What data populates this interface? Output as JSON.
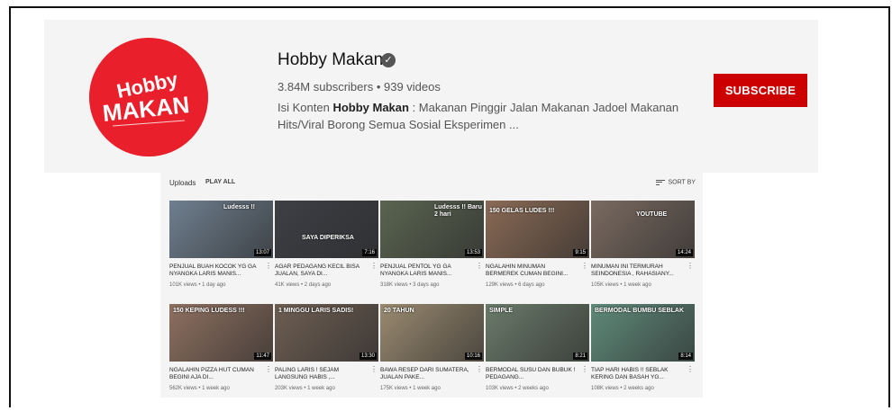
{
  "channel": {
    "name": "Hobby Makan",
    "stats": "3.84M subscribers • 939 videos",
    "description_lead": "Isi Konten ",
    "description_bold": "Hobby Makan",
    "description_rest": " : Makanan Pinggir Jalan Makanan Jadoel Makanan Hits/Viral Borong Semua Sosial Eksperimen ...",
    "subscribe_label": "SUBSCRIBE",
    "logo_top": "Hobby",
    "logo_bottom": "MAKAN",
    "accent": "#cc0000"
  },
  "uploads": {
    "title": "Uploads",
    "play_all": "PLAY ALL",
    "sort_label": "SORT BY",
    "videos": [
      {
        "title": "PENJUAL BUAH KOCOK YG GA NYANGKA LARIS MANIS...",
        "meta": "101K views • 1 day ago",
        "duration": "13:07",
        "caption": "Ludesss !!",
        "bg": "#6f7f8f"
      },
      {
        "title": "AGAR PEDAGANG KECIL BISA JUALAN, SAYA DI...",
        "meta": "41K views • 2 days ago",
        "duration": "7:16",
        "caption": "SAYA DIPERIKSA",
        "bg": "#3d3f45"
      },
      {
        "title": "PENJUAL PENTOL YG GA NYANGKA LARIS MANIS...",
        "meta": "318K views • 3 days ago",
        "duration": "13:53",
        "caption": "Ludesss !! Baru 2 hari",
        "bg": "#5a6450"
      },
      {
        "title": "NGALAHIN MINUMAN BERMEREK CUMAN BEGINI...",
        "meta": "129K views • 6 days ago",
        "duration": "9:15",
        "caption": "150 GELAS LUDES !!!",
        "bg": "#8a6a55"
      },
      {
        "title": "MINUMAN INI TERMURAH SEINDONESIA , RAHASIANY...",
        "meta": "105K views • 1 week ago",
        "duration": "14:24",
        "caption": "YOUTUBE",
        "bg": "#7a6a60"
      },
      {
        "title": "NGALAHIN PIZZA HUT CUMAN BEGINI AJA DI...",
        "meta": "562K views • 1 week ago",
        "duration": "11:47",
        "caption": "150 KEPING LUDESS !!!",
        "bg": "#8e7060"
      },
      {
        "title": "PALING LARIS ! SEJAM LANGSUNG HABIS ,...",
        "meta": "203K views • 1 week ago",
        "duration": "13:30",
        "caption": "1 MINGGU LARIS SADIS!",
        "bg": "#6e5e52"
      },
      {
        "title": "BAWA RESEP DARI SUMATERA, JUALAN PAKE...",
        "meta": "175K views • 1 week ago",
        "duration": "10:16",
        "caption": "20 TAHUN",
        "bg": "#9a8a70"
      },
      {
        "title": "BERMODAL SUSU DAN BUBUK ! PEDAGANG...",
        "meta": "103K views • 2 weeks ago",
        "duration": "8:21",
        "caption": "SIMPLE",
        "bg": "#6a7a6a"
      },
      {
        "title": "TIAP HARI HABIS !! SEBLAK KERING DAN BASAH YG...",
        "meta": "108K views • 2 weeks ago",
        "duration": "8:14",
        "caption": "BERMODAL BUMBU SEBLAK",
        "bg": "#5f8a7a"
      }
    ]
  }
}
